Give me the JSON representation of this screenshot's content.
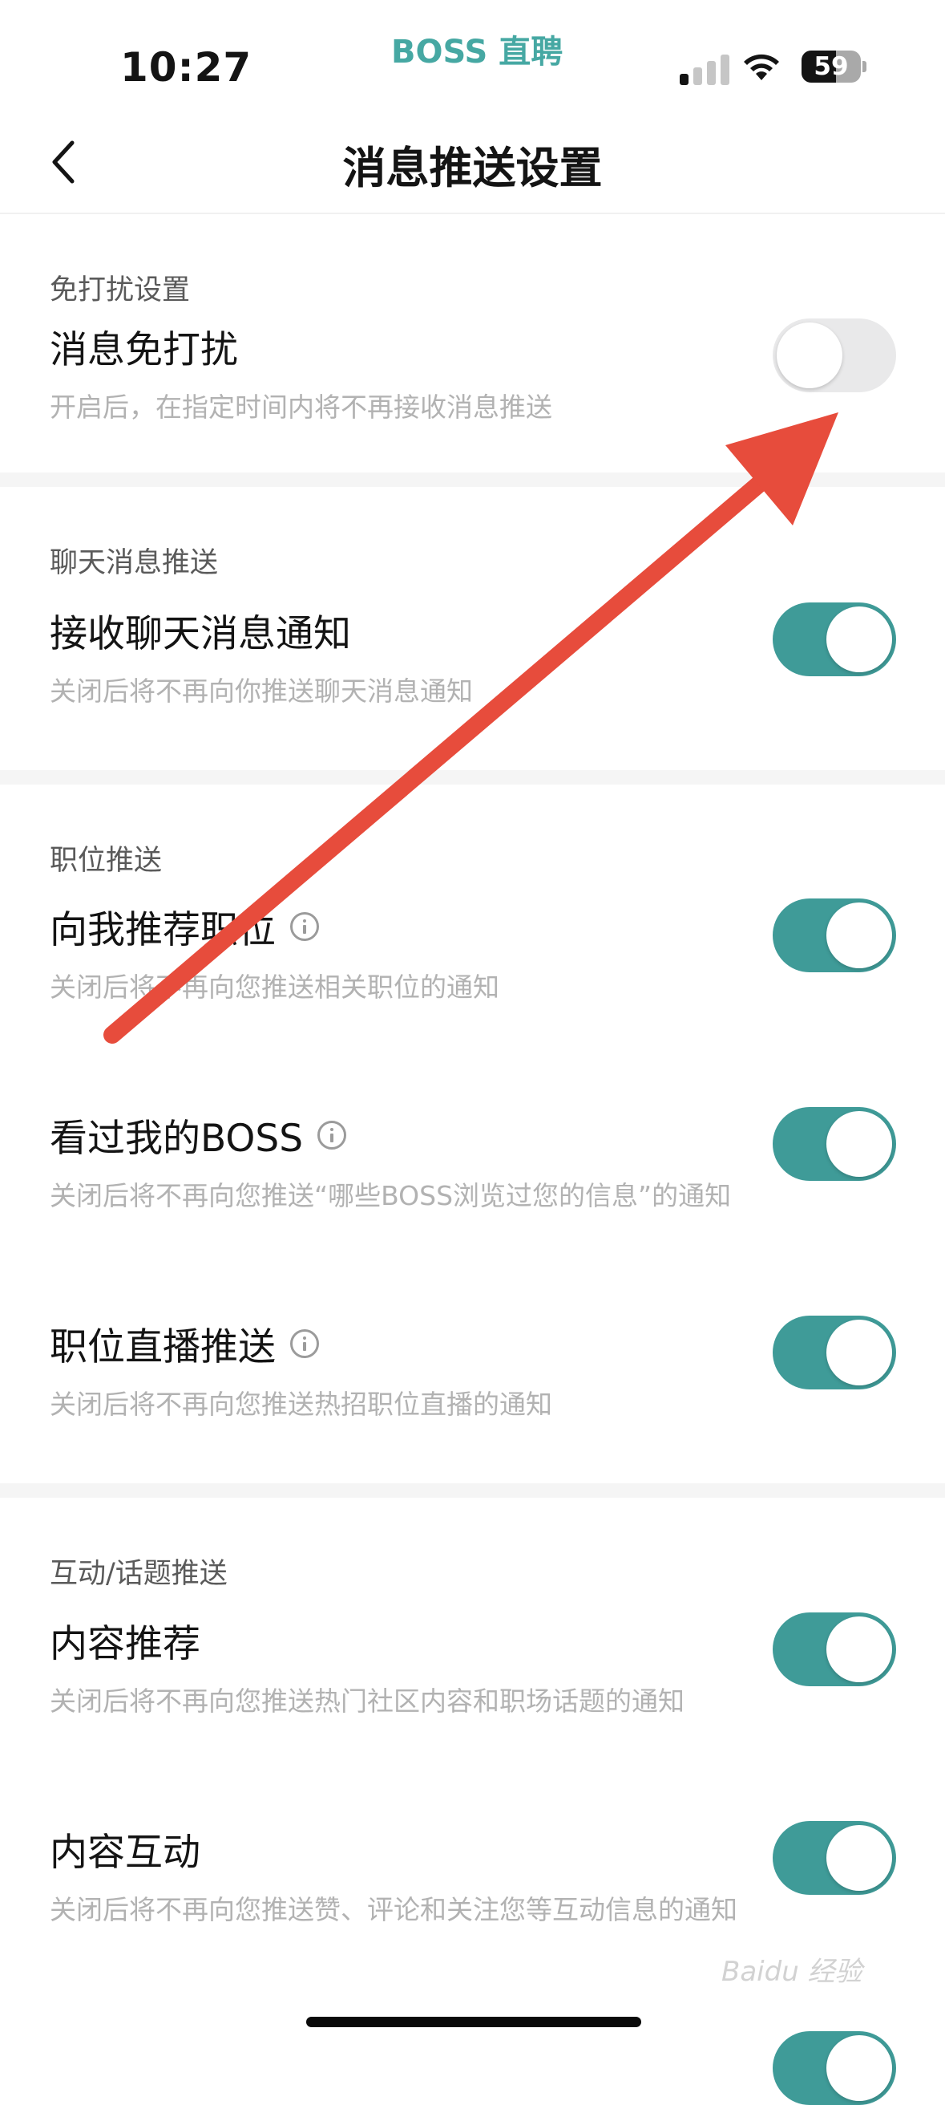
{
  "status_bar": {
    "time": "10:27",
    "brand": "BOSS 直聘",
    "battery": "59"
  },
  "nav": {
    "title": "消息推送设置"
  },
  "sections": [
    {
      "title": "免打扰设置",
      "items": [
        {
          "label": "消息免打扰",
          "desc": "开启后，在指定时间内将不再接收消息推送",
          "enabled": false
        }
      ]
    },
    {
      "title": "聊天消息推送",
      "items": [
        {
          "label": "接收聊天消息通知",
          "desc": "关闭后将不再向你推送聊天消息通知",
          "enabled": true
        }
      ]
    },
    {
      "title": "职位推送",
      "items": [
        {
          "label": "向我推荐职位",
          "desc": "关闭后将不再向您推送相关职位的通知",
          "enabled": true
        },
        {
          "label": "看过我的BOSS",
          "desc": "关闭后将不再向您推送“哪些BOSS浏览过您的信息”的通知",
          "enabled": true
        },
        {
          "label": "职位直播推送",
          "desc": "关闭后将不再向您推送热招职位直播的通知",
          "enabled": true
        }
      ]
    },
    {
      "title": "互动/话题推送",
      "items": [
        {
          "label": "内容推荐",
          "desc": "关闭后将不再向您推送热门社区内容和职场话题的通知",
          "enabled": true
        },
        {
          "label": "内容互动",
          "desc": "关闭后将不再向您推送赞、评论和关注您等互动信息的通知",
          "enabled": true
        }
      ]
    }
  ],
  "watermark": "Baidu 经验",
  "colors": {
    "toggle_on": "#3f9b98",
    "toggle_off": "#e9e9ea",
    "brand": "#46a8a3",
    "annotation_arrow": "#e74c3c"
  }
}
